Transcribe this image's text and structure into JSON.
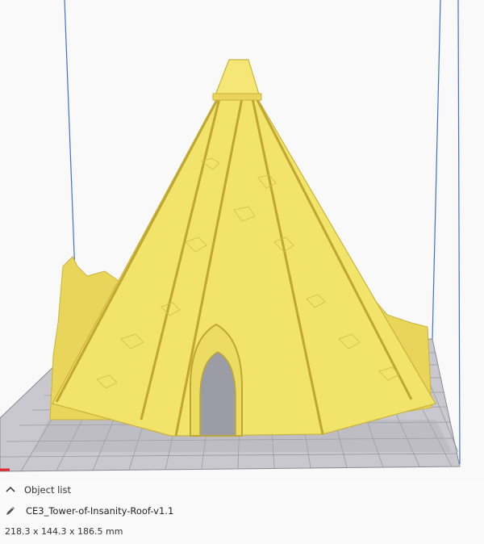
{
  "viewport": {
    "model_color": "#F2E36B",
    "background_color": "#F9F9F9",
    "build_volume_line_color": "#3E6FD8",
    "plate_color": "#C8C8CE",
    "grid_line_color": "#9A9AA6",
    "axis_x_color": "#E2242B",
    "model_icon": "tower-roof-model"
  },
  "object_panel": {
    "toggle_icon": "chevron-up-icon",
    "title": "Object list",
    "edit_icon": "pencil-icon",
    "file_name": "CE3_Tower-of-Insanity-Roof-v1.1",
    "dimensions": "218.3 x 144.3 x 186.5 mm"
  }
}
